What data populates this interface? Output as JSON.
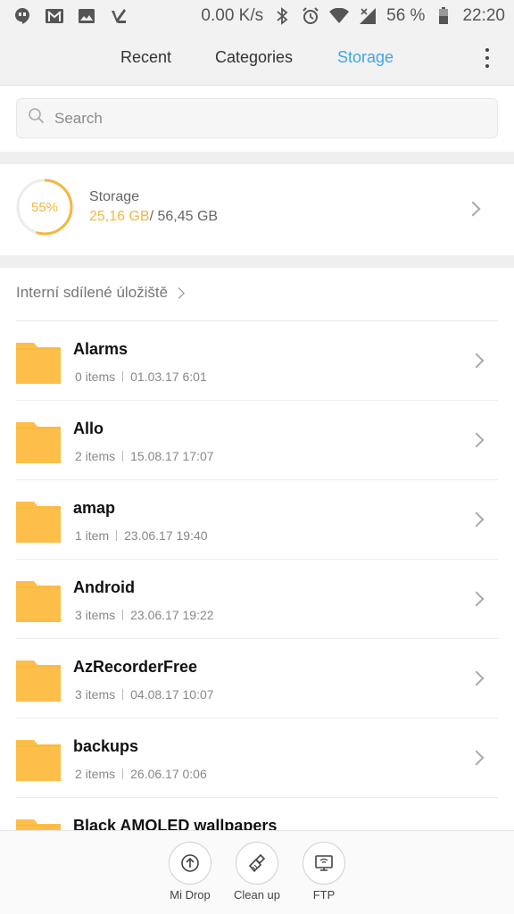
{
  "status_bar": {
    "speed": "0.00 K/s",
    "battery": "56 %",
    "time": "22:20",
    "icons_left": [
      "hangouts-icon",
      "gmail-icon",
      "gallery-icon",
      "tasks-icon"
    ],
    "icons_right": [
      "bluetooth-icon",
      "alarm-icon",
      "wifi-icon",
      "signal-icon",
      "battery-icon"
    ]
  },
  "tabs": [
    {
      "label": "Recent",
      "active": false
    },
    {
      "label": "Categories",
      "active": false
    },
    {
      "label": "Storage",
      "active": true
    }
  ],
  "search": {
    "placeholder": "Search"
  },
  "storage": {
    "percent": 55,
    "percent_label": "55%",
    "title": "Storage",
    "used": "25,16 GB",
    "total": "/ 56,45 GB"
  },
  "breadcrumb": "Interní sdílené úložiště",
  "folders": [
    {
      "name": "Alarms",
      "items": "0 items",
      "date": "01.03.17 6:01"
    },
    {
      "name": "Allo",
      "items": "2 items",
      "date": "15.08.17 17:07"
    },
    {
      "name": "amap",
      "items": "1 item",
      "date": "23.06.17 19:40"
    },
    {
      "name": "Android",
      "items": "3 items",
      "date": "23.06.17 19:22"
    },
    {
      "name": "AzRecorderFree",
      "items": "3 items",
      "date": "04.08.17 10:07"
    },
    {
      "name": "backups",
      "items": "2 items",
      "date": "26.06.17 0:06"
    },
    {
      "name": "Black AMOLED wallpapers",
      "items": "",
      "date": ""
    }
  ],
  "actions": [
    {
      "label": "Mi Drop",
      "icon": "upload-icon"
    },
    {
      "label": "Clean up",
      "icon": "broom-icon"
    },
    {
      "label": "FTP",
      "icon": "ftp-icon"
    }
  ],
  "colors": {
    "accent": "#3ea6e8",
    "storage": "#f5b73d",
    "folder": "#fdbf4a"
  }
}
